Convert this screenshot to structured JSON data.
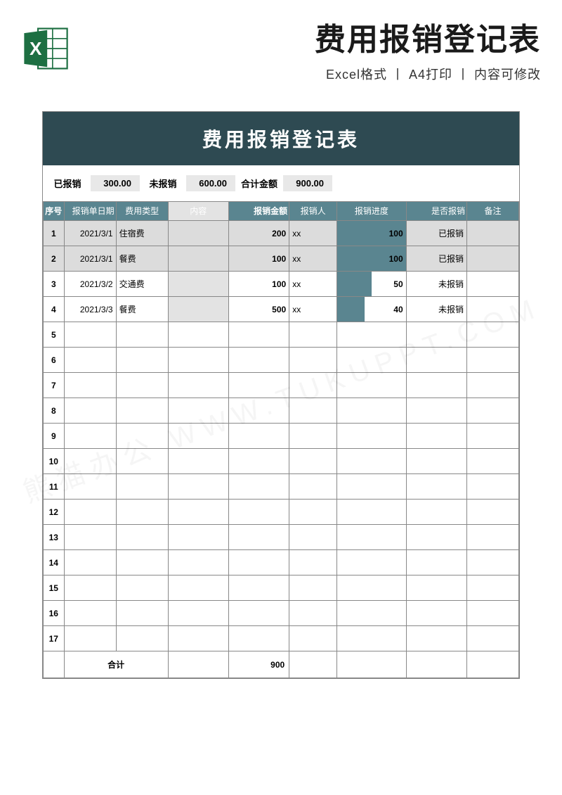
{
  "header": {
    "title": "费用报销登记表",
    "subtitle": "Excel格式 丨 A4打印 丨 内容可修改",
    "icon_label": "X"
  },
  "sheet": {
    "title": "费用报销登记表",
    "summary": {
      "reimbursed_label": "已报销",
      "reimbursed_value": "300.00",
      "not_reimbursed_label": "未报销",
      "not_reimbursed_value": "600.00",
      "total_label": "合计金额",
      "total_value": "900.00"
    },
    "columns": {
      "seq": "序号",
      "date": "报销单日期",
      "type": "费用类型",
      "content": "内容",
      "amount": "报销金额",
      "person": "报销人",
      "progress": "报销进度",
      "status": "是否报销",
      "remark": "备注"
    },
    "rows": [
      {
        "seq": "1",
        "date": "2021/3/1",
        "type": "住宿费",
        "content": "",
        "amount": "200",
        "person": "xx",
        "progress": 100,
        "status": "已报销",
        "remark": "",
        "gray": true
      },
      {
        "seq": "2",
        "date": "2021/3/1",
        "type": "餐费",
        "content": "",
        "amount": "100",
        "person": "xx",
        "progress": 100,
        "status": "已报销",
        "remark": "",
        "gray": true
      },
      {
        "seq": "3",
        "date": "2021/3/2",
        "type": "交通费",
        "content": "",
        "amount": "100",
        "person": "xx",
        "progress": 50,
        "status": "未报销",
        "remark": "",
        "gray": false
      },
      {
        "seq": "4",
        "date": "2021/3/3",
        "type": "餐费",
        "content": "",
        "amount": "500",
        "person": "xx",
        "progress": 40,
        "status": "未报销",
        "remark": "",
        "gray": false
      }
    ],
    "empty_rows": [
      "5",
      "6",
      "7",
      "8",
      "9",
      "10",
      "11",
      "12",
      "13",
      "14",
      "15",
      "16",
      "17"
    ],
    "total": {
      "label": "合计",
      "amount": "900"
    }
  }
}
